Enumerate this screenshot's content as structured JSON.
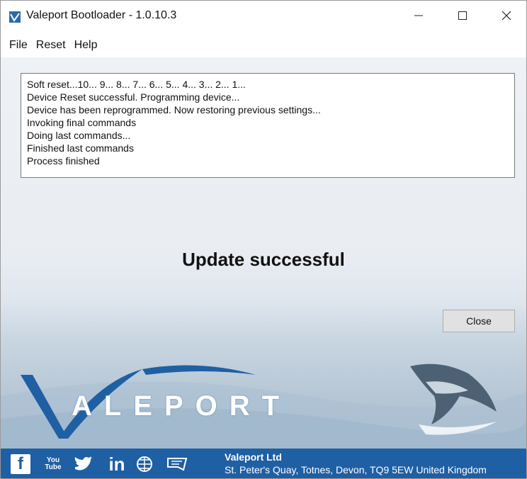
{
  "window": {
    "title": "Valeport Bootloader - 1.0.10.3",
    "icon": "valeport-app-icon",
    "controls": {
      "minimize": "minimize-icon",
      "maximize": "maximize-icon",
      "close": "close-icon"
    }
  },
  "menu": {
    "items": [
      "File",
      "Reset",
      "Help"
    ]
  },
  "log": {
    "lines": [
      "Soft reset...10... 9... 8... 7... 6... 5... 4... 3... 2... 1...",
      "Device Reset successful. Programming device...",
      "Device has been reprogrammed. Now restoring previous settings...",
      "Invoking final commands",
      "Doing last commands...",
      "Finished last commands",
      "Process finished"
    ]
  },
  "status": "Update successful",
  "buttons": {
    "close": "Close"
  },
  "branding": {
    "logo_text": "VALEPORT",
    "logo_rest": "ALEPORT",
    "image": "dolphin-icon"
  },
  "footer": {
    "company": "Valeport Ltd",
    "address": "St. Peter's Quay, Totnes, Devon, TQ9 5EW United Kingdom",
    "social_icons": [
      "facebook-icon",
      "youtube-icon",
      "twitter-icon",
      "linkedin-icon",
      "website-icon",
      "chat-icon"
    ],
    "youtube_top": "You",
    "youtube_bottom": "Tube",
    "facebook_glyph": "f",
    "linkedin_glyph": "in"
  },
  "colors": {
    "footer": "#1f5fa4",
    "logo_blue": "#1f5fa4",
    "background": "#eef1f5"
  }
}
